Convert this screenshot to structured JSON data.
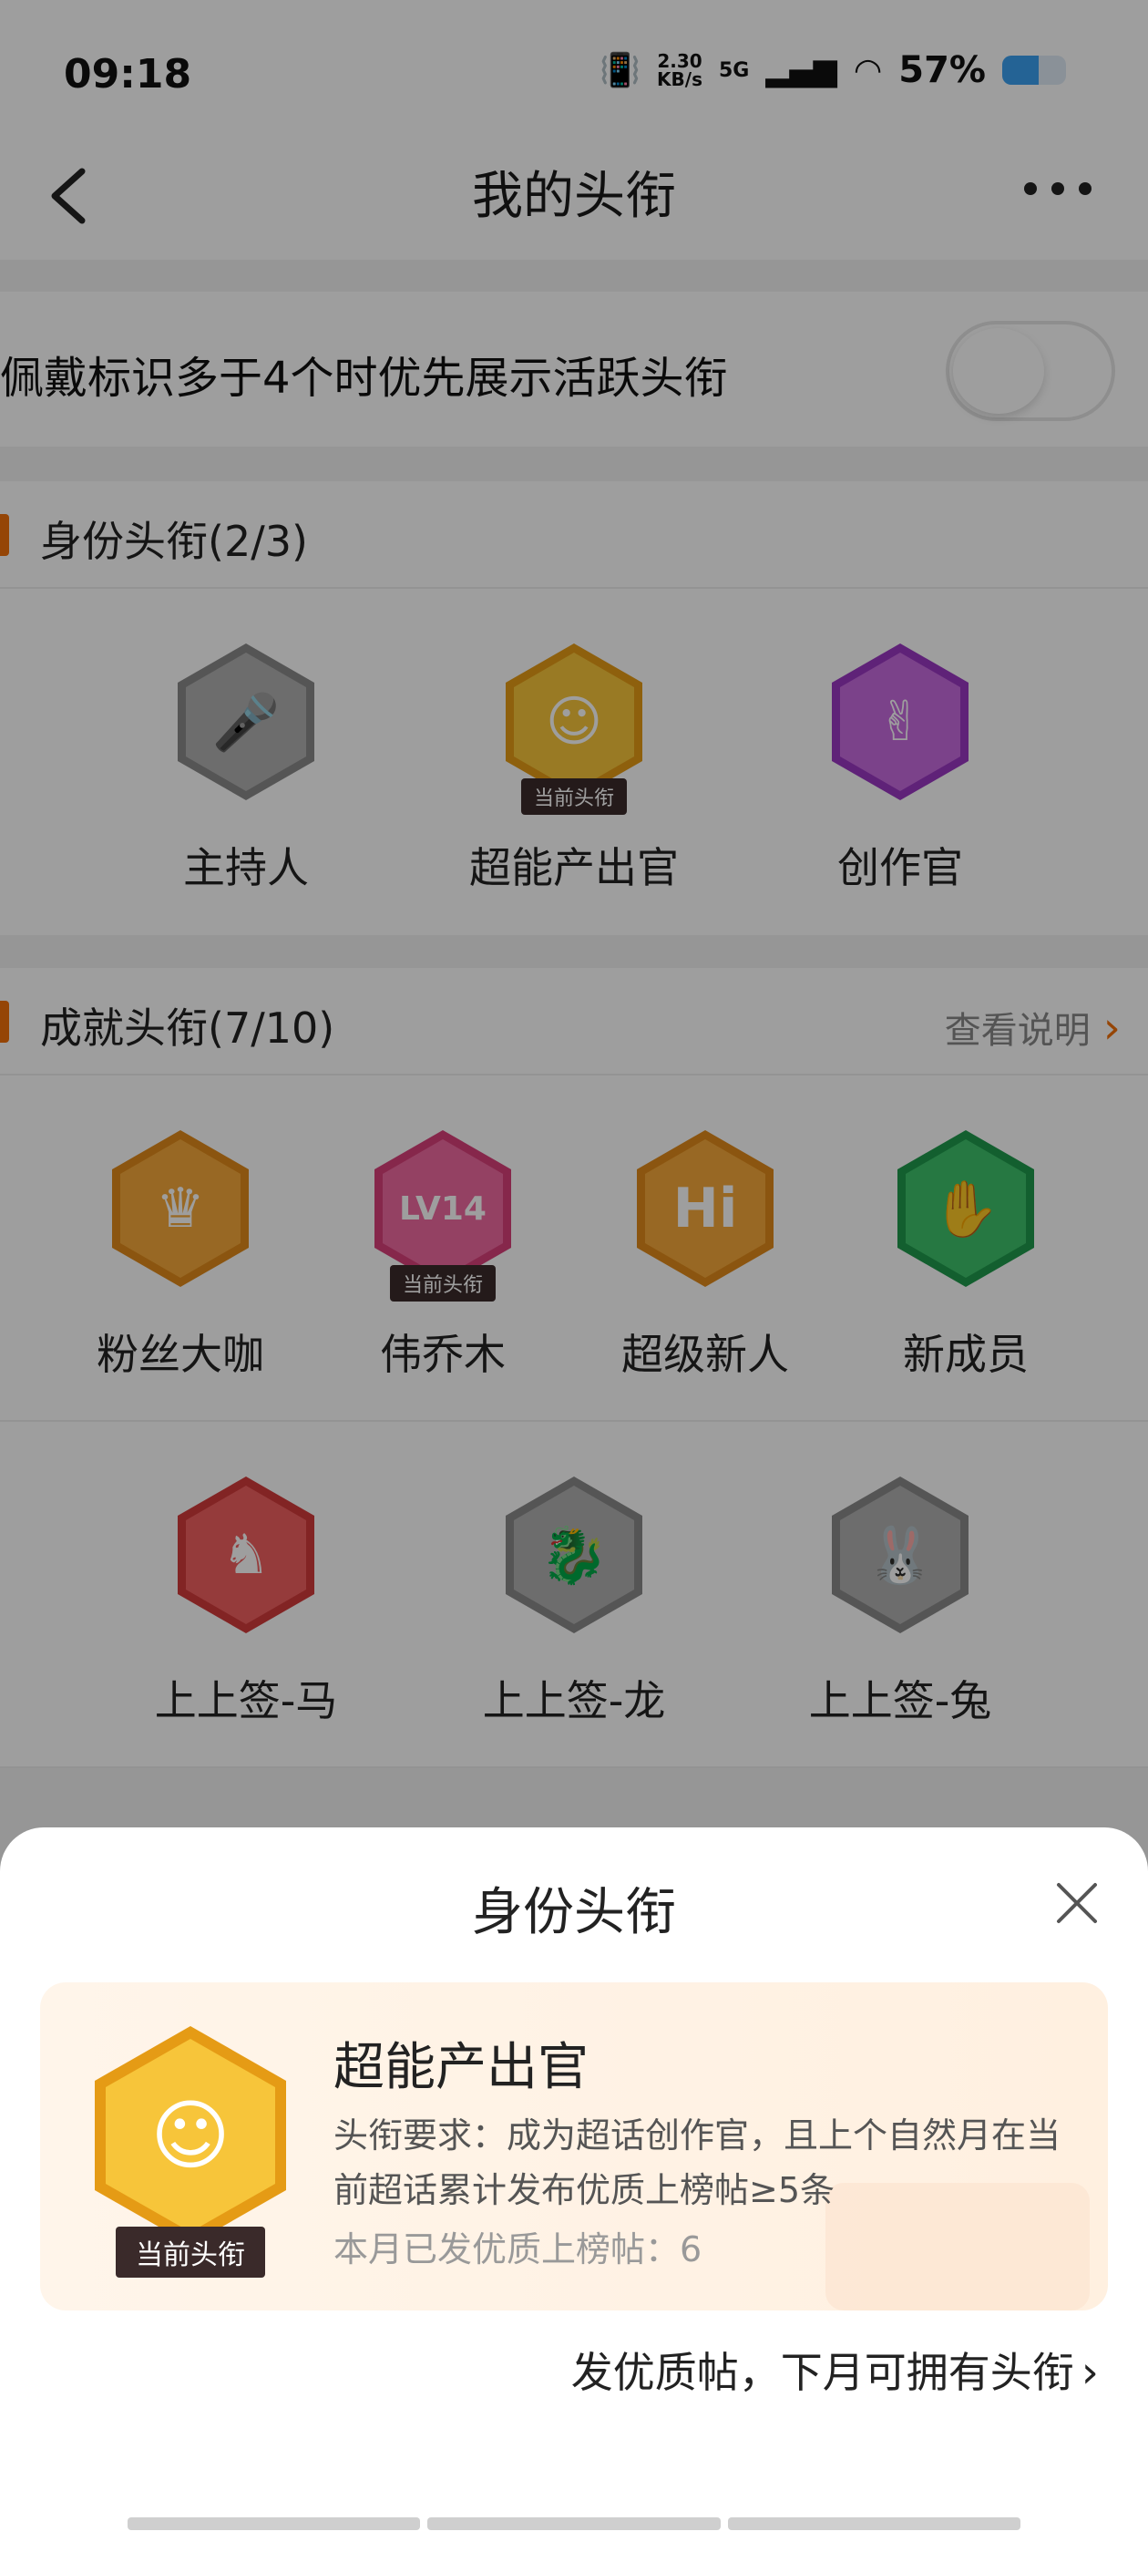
{
  "status": {
    "time": "09:18",
    "net_speed": "2.30",
    "net_unit": "KB/s",
    "signal": "5G",
    "battery_pct": "57%",
    "battery_level": 0.57
  },
  "nav": {
    "title": "我的头衔"
  },
  "toggle": {
    "label": "佩戴标识多于4个时优先展示活跃头衔",
    "on": false
  },
  "identity_section": {
    "title": "身份头衔(2/3)",
    "badges": [
      {
        "label": "主持人",
        "icon": "microphone-badge-icon",
        "color": "#8a8a8a",
        "symbol": "🎤",
        "tag": ""
      },
      {
        "label": "超能产出官",
        "icon": "yellow-mascot-badge-icon",
        "color": "#e59b15",
        "symbol": "☺",
        "tag": "当前头衔"
      },
      {
        "label": "创作官",
        "icon": "hand-pen-badge-icon",
        "color": "#9a38c2",
        "symbol": "✌",
        "tag": ""
      }
    ]
  },
  "achievement_section": {
    "title": "成就头衔(7/10)",
    "link": "查看说明",
    "row1": [
      {
        "label": "粉丝大咖",
        "icon": "crown-badge-icon",
        "symbol": "♛",
        "tag": ""
      },
      {
        "label": "伟乔木",
        "icon": "level-14-badge-icon",
        "symbol": "LV14",
        "tag": "当前头衔"
      },
      {
        "label": "超级新人",
        "icon": "hi-badge-icon",
        "symbol": "Hi",
        "tag": ""
      },
      {
        "label": "新成员",
        "icon": "wave-hand-badge-icon",
        "symbol": "✋",
        "tag": ""
      }
    ],
    "row2": [
      {
        "label": "上上签-马",
        "icon": "horse-badge-icon",
        "symbol": "♞",
        "tag": ""
      },
      {
        "label": "上上签-龙",
        "icon": "dragon-badge-icon",
        "symbol": "龍",
        "tag": ""
      },
      {
        "label": "上上签-兔",
        "icon": "rabbit-badge-icon",
        "symbol": "兔",
        "tag": ""
      }
    ]
  },
  "sheet": {
    "title": "身份头衔",
    "badge_name": "超能产出官",
    "badge_tag": "当前头衔",
    "requirement": "头衔要求：成为超话创作官，且上个自然月在当前超话累计发布优质上榜帖≥5条",
    "count": "本月已发优质上榜帖：6",
    "link": "发优质帖，下月可拥有头衔"
  }
}
